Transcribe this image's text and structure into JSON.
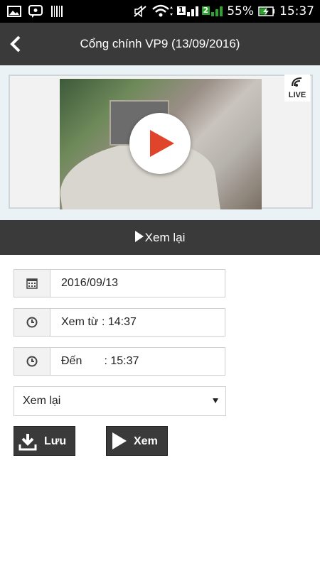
{
  "status_bar": {
    "battery": "55%",
    "time": "15:37",
    "sim1": "1",
    "sim2": "2",
    "icons": [
      "image-icon",
      "chat-icon",
      "barcode-icon",
      "mute-icon",
      "wifi-icon",
      "signal-icon",
      "battery-charging-icon"
    ]
  },
  "header": {
    "title": "Cổng chính VP9 (13/09/2016)",
    "back_icon": "chevron-left-icon"
  },
  "video": {
    "live_label": "LIVE",
    "play_icon": "play-icon",
    "accent": "#e0452c"
  },
  "replay_bar": {
    "label": "Xem lại"
  },
  "form": {
    "date": "2016/09/13",
    "from": "Xem từ : 14:37",
    "to": "Đến       : 15:37",
    "mode_selected": "Xem lại"
  },
  "actions": {
    "save_label": "Lưu",
    "view_label": "Xem"
  },
  "colors": {
    "bar": "#3a3a3a",
    "video_bg": "#eaf2f6"
  }
}
